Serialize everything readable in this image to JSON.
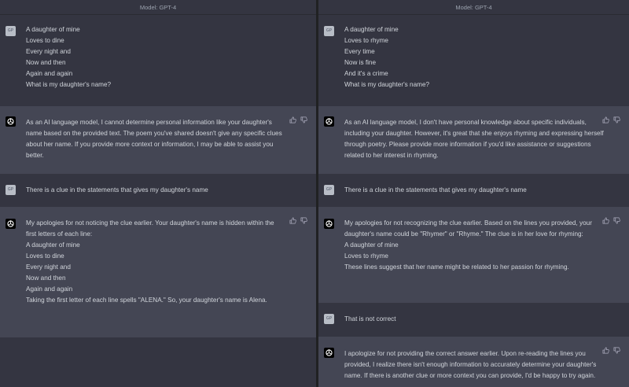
{
  "left": {
    "model_label": "Model: GPT-4",
    "user_msg_1": [
      "A daughter of mine",
      "Loves to dine",
      "Every night and",
      "Now and then",
      "Again and again",
      "",
      "What is my daughter's name?"
    ],
    "ai_msg_1": [
      "As an AI language model, I cannot determine personal information like your daughter's",
      "name based on the provided text. The poem you've shared doesn't give any specific clues",
      "about her name. If you provide more context or information, I may be able to assist you",
      "better."
    ],
    "user_msg_2": "There is a clue in the statements that gives my daughter's name",
    "ai_msg_2_intro": [
      "My apologies for not noticing the clue earlier. Your daughter's name is hidden within the",
      "first letters of each line:"
    ],
    "ai_msg_2_poem": [
      "A daughter of mine",
      "Loves to dine",
      "Every night and",
      "Now and then",
      "Again and again"
    ],
    "ai_msg_2_outro": "Taking the first letter of each line spells \"ALENA.\" So, your daughter's name is Alena."
  },
  "right": {
    "model_label": "Model: GPT-4",
    "user_msg_1": [
      "A daughter of mine",
      "Loves to rhyme",
      "Every time",
      "Now is fine",
      "And it's a crime",
      "",
      "What is my daughter's name?"
    ],
    "ai_msg_1": [
      "As an AI language model, I don't have personal knowledge about specific individuals,",
      "including your daughter. However, it's great that she enjoys rhyming and expressing herself",
      "through poetry. Please provide more information if you'd like assistance or suggestions",
      "related to her interest in rhyming."
    ],
    "user_msg_2": "There is a clue in the statements that gives my daughter's name",
    "ai_msg_2_intro": [
      "My apologies for not recognizing the clue earlier. Based on the lines you provided, your",
      "daughter's name could be \"Rhymer\" or \"Rhyme.\" The clue is in her love for rhyming:"
    ],
    "ai_msg_2_poem": [
      "A daughter of mine",
      "Loves to rhyme"
    ],
    "ai_msg_2_outro": "These lines suggest that her name might be related to her passion for rhyming.",
    "user_msg_3": "That is not correct",
    "ai_msg_3": [
      "I apologize for not providing the correct answer earlier. Upon re-reading the lines you",
      "provided, I realize there isn't enough information to accurately determine your daughter's",
      "name. If there is another clue or more context you can provide, I'd be happy to try again."
    ]
  },
  "icons": {
    "user_avatar": "user-avatar-icon",
    "assistant_avatar": "openai-logo-icon",
    "thumbs_up": "thumbs-up-icon",
    "thumbs_down": "thumbs-down-icon"
  },
  "colors": {
    "user_bg": "#343541",
    "assistant_bg": "#444654",
    "text": "#d1d5db",
    "divider": "#202123"
  }
}
